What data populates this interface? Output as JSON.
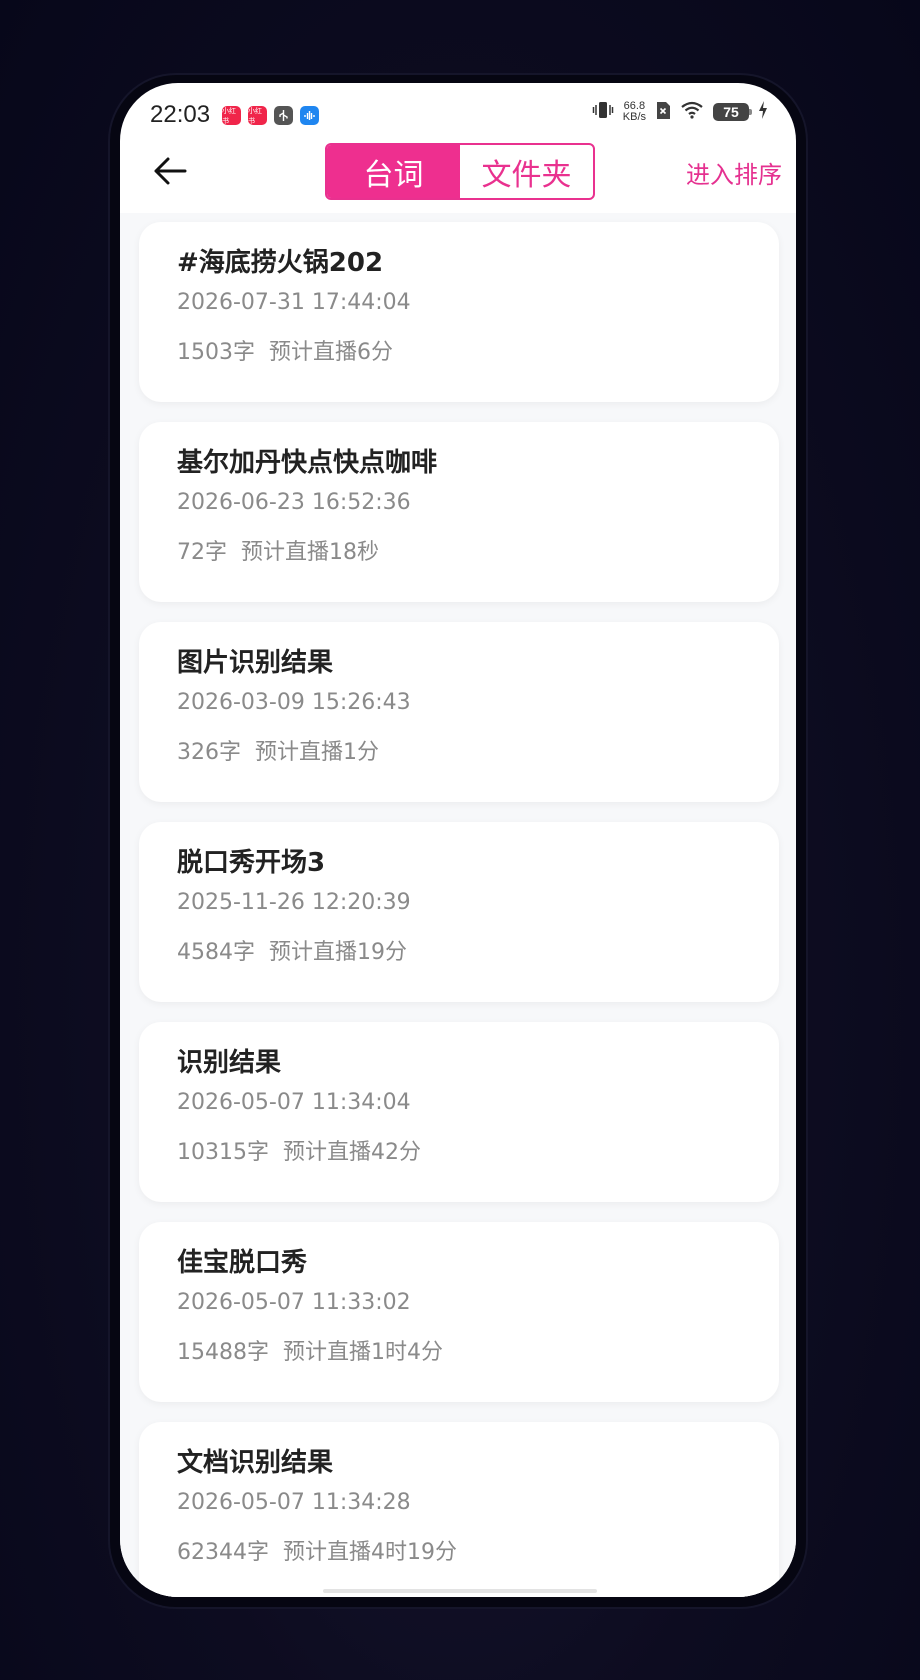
{
  "status_bar": {
    "time": "22:03",
    "app_icons": [
      {
        "name": "xiaohongshu-icon",
        "label": "小红书",
        "color": "#f0254a"
      },
      {
        "name": "xiaohongshu-icon",
        "label": "小红书",
        "color": "#f0254a"
      },
      {
        "name": "usb-icon",
        "label": "",
        "color": "#555555"
      },
      {
        "name": "voice-app-icon",
        "label": "",
        "color": "#1f86f0"
      }
    ],
    "net_speed_value": "66.8",
    "net_speed_unit": "KB/s",
    "battery_level": "75"
  },
  "header": {
    "tabs": [
      {
        "label": "台词",
        "active": true
      },
      {
        "label": "文件夹",
        "active": false
      }
    ],
    "sort_label": "进入排序"
  },
  "scripts": [
    {
      "title": "#海底捞火锅202",
      "date": "2026-07-31 17:44:04",
      "words": "1503字",
      "duration": "预计直播6分"
    },
    {
      "title": "基尔加丹快点快点咖啡",
      "date": "2026-06-23 16:52:36",
      "words": "72字",
      "duration": "预计直播18秒"
    },
    {
      "title": "图片识别结果",
      "date": "2026-03-09 15:26:43",
      "words": "326字",
      "duration": "预计直播1分"
    },
    {
      "title": "脱口秀开场3",
      "date": "2025-11-26 12:20:39",
      "words": "4584字",
      "duration": "预计直播19分"
    },
    {
      "title": "识别结果",
      "date": "2026-05-07 11:34:04",
      "words": "10315字",
      "duration": "预计直播42分"
    },
    {
      "title": "佳宝脱口秀",
      "date": "2026-05-07 11:33:02",
      "words": "15488字",
      "duration": "预计直播1时4分"
    },
    {
      "title": "文档识别结果",
      "date": "2026-05-07 11:34:28",
      "words": "62344字",
      "duration": "预计直播4时19分"
    }
  ],
  "colors": {
    "accent": "#ee2f8f",
    "text_primary": "#222222",
    "text_secondary": "#8a8a8a"
  }
}
